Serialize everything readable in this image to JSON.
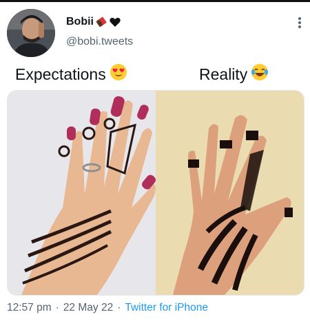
{
  "tweet": {
    "display_name": "Bobii",
    "name_emojis": [
      "chocolate-bar-emoji",
      "black-heart-emoji"
    ],
    "handle": "@bobi.tweets",
    "caption_left": "Expectations",
    "caption_left_emoji": "heart-eyes-emoji",
    "caption_right": "Reality",
    "caption_right_emoji": "laughing-tears-emoji",
    "time": "12:57 pm",
    "separator": "·",
    "date": "22 May 22",
    "source": "Twitter for iPhone"
  },
  "colors": {
    "link": "#1d9bf0",
    "secondary_text": "#536471",
    "primary_text": "#0f1419"
  }
}
